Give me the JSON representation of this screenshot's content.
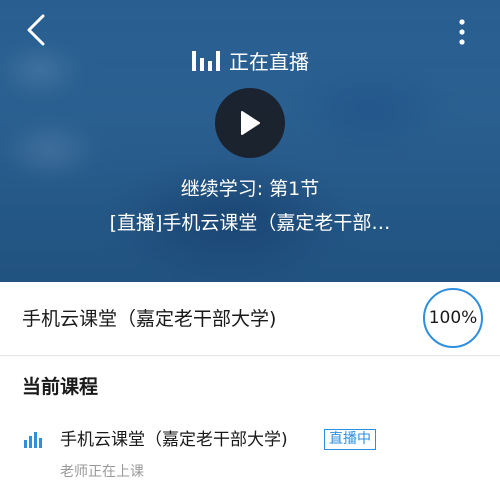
{
  "player": {
    "live_status": "正在直播",
    "resume_text": "继续学习: 第1节",
    "lesson_title": "[直播]手机云课堂（嘉定老干部…",
    "icons": {
      "back": "chevron-left-icon",
      "more": "more-vertical-icon",
      "live": "live-bars-icon",
      "play": "play-icon"
    }
  },
  "course": {
    "name": "手机云课堂（嘉定老干部大学)",
    "progress_label": "100%",
    "progress_value": 1.0
  },
  "current_section": {
    "title": "当前课程",
    "items": [
      {
        "name": "手机云课堂（嘉定老干部大学)",
        "badge": "直播中",
        "subtitle": "老师正在上课"
      }
    ]
  },
  "colors": {
    "accent": "#2f8fdf",
    "hero_bg": "#285f93",
    "muted_text": "#9a9a9a"
  }
}
